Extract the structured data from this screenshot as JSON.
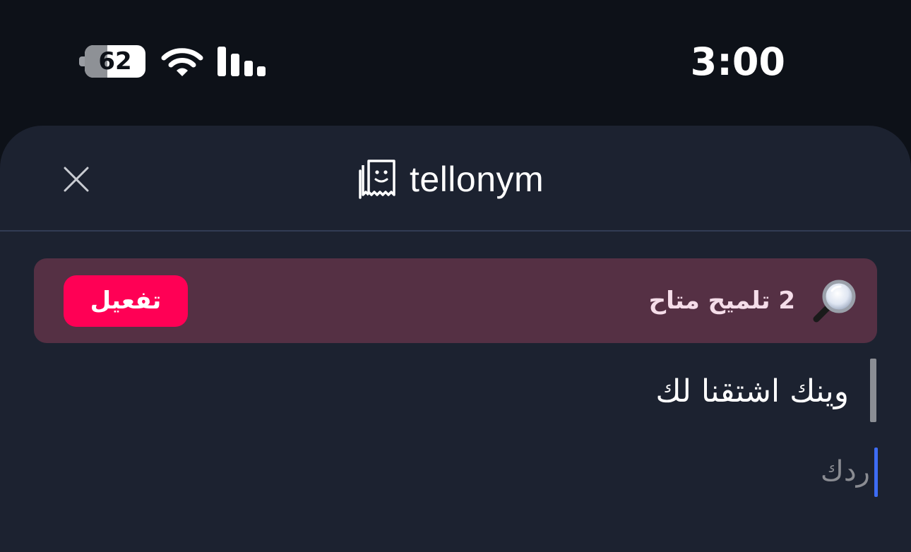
{
  "status_bar": {
    "battery_level": "62",
    "battery_fraction": 0.62,
    "wifi_icon": "wifi-icon",
    "signal_icon": "cellular-signal-icon",
    "time": "3:00"
  },
  "header": {
    "close_icon": "close-icon",
    "logo_icon": "tellonym-logo-icon",
    "logo_text": "tellonym"
  },
  "hint_banner": {
    "icon": "magnifying-glass-icon",
    "text": "2 تلميح متاح",
    "button_label": "تفعيل",
    "background_color": "#553044",
    "button_color": "#ff0055"
  },
  "question": {
    "text": "وينك اشتقنا لك"
  },
  "answer": {
    "placeholder": "ردك",
    "value": "",
    "caret_color": "#3d6cf5"
  },
  "colors": {
    "page_background": "#0d1118",
    "sheet_background": "#1c2230"
  }
}
